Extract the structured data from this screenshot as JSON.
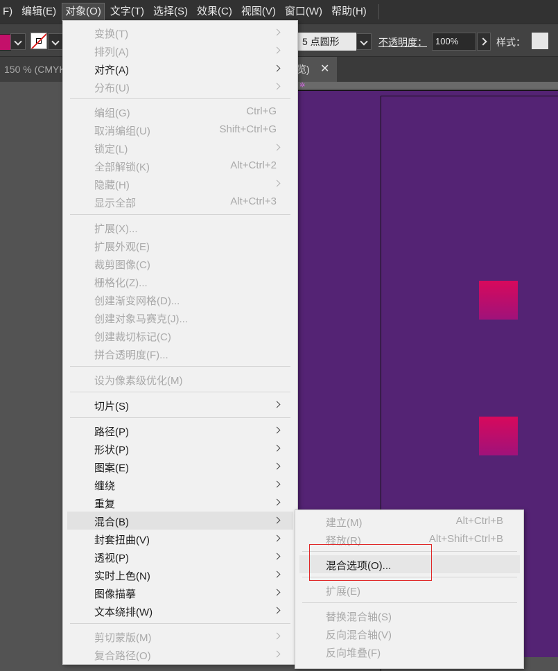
{
  "menubar": {
    "items": [
      "F)",
      "编辑(E)",
      "对象(O)",
      "文字(T)",
      "选择(S)",
      "效果(C)",
      "视图(V)",
      "窗口(W)",
      "帮助(H)"
    ],
    "active_index": 2
  },
  "controlbar": {
    "fill_color": "#c4106a",
    "brush": "5 点圆形",
    "opacity_label": "不透明度：",
    "opacity_value": "100%",
    "style_label": "样式："
  },
  "tabs": {
    "left_tab": "150 % (CMYK",
    "right_tab": "览)",
    "close_glyph": "✕"
  },
  "canvas": {
    "artboard_color": "#542374",
    "square_color": "#c4106a"
  },
  "object_menu": {
    "items": [
      {
        "label": "变换(T)",
        "shortcut": "",
        "submenu": true,
        "enabled": false
      },
      {
        "label": "排列(A)",
        "shortcut": "",
        "submenu": true,
        "enabled": false
      },
      {
        "label": "对齐(A)",
        "shortcut": "",
        "submenu": true,
        "enabled": true
      },
      {
        "label": "分布(U)",
        "shortcut": "",
        "submenu": true,
        "enabled": false
      },
      {
        "label": "编组(G)",
        "shortcut": "Ctrl+G",
        "submenu": false,
        "enabled": false
      },
      {
        "label": "取消编组(U)",
        "shortcut": "Shift+Ctrl+G",
        "submenu": false,
        "enabled": false
      },
      {
        "label": "锁定(L)",
        "shortcut": "",
        "submenu": true,
        "enabled": false
      },
      {
        "label": "全部解锁(K)",
        "shortcut": "Alt+Ctrl+2",
        "submenu": false,
        "enabled": false
      },
      {
        "label": "隐藏(H)",
        "shortcut": "",
        "submenu": true,
        "enabled": false
      },
      {
        "label": "显示全部",
        "shortcut": "Alt+Ctrl+3",
        "submenu": false,
        "enabled": false
      },
      {
        "label": "扩展(X)...",
        "shortcut": "",
        "submenu": false,
        "enabled": false
      },
      {
        "label": "扩展外观(E)",
        "shortcut": "",
        "submenu": false,
        "enabled": false
      },
      {
        "label": "裁剪图像(C)",
        "shortcut": "",
        "submenu": false,
        "enabled": false
      },
      {
        "label": "栅格化(Z)...",
        "shortcut": "",
        "submenu": false,
        "enabled": false
      },
      {
        "label": "创建渐变网格(D)...",
        "shortcut": "",
        "submenu": false,
        "enabled": false
      },
      {
        "label": "创建对象马赛克(J)...",
        "shortcut": "",
        "submenu": false,
        "enabled": false
      },
      {
        "label": "创建裁切标记(C)",
        "shortcut": "",
        "submenu": false,
        "enabled": false
      },
      {
        "label": "拼合透明度(F)...",
        "shortcut": "",
        "submenu": false,
        "enabled": false
      },
      {
        "label": "设为像素级优化(M)",
        "shortcut": "",
        "submenu": false,
        "enabled": false
      },
      {
        "label": "切片(S)",
        "shortcut": "",
        "submenu": true,
        "enabled": true
      },
      {
        "label": "路径(P)",
        "shortcut": "",
        "submenu": true,
        "enabled": true
      },
      {
        "label": "形状(P)",
        "shortcut": "",
        "submenu": true,
        "enabled": true
      },
      {
        "label": "图案(E)",
        "shortcut": "",
        "submenu": true,
        "enabled": true
      },
      {
        "label": "缠绕",
        "shortcut": "",
        "submenu": true,
        "enabled": true
      },
      {
        "label": "重复",
        "shortcut": "",
        "submenu": true,
        "enabled": true
      },
      {
        "label": "混合(B)",
        "shortcut": "",
        "submenu": true,
        "enabled": true,
        "hover": true
      },
      {
        "label": "封套扭曲(V)",
        "shortcut": "",
        "submenu": true,
        "enabled": true
      },
      {
        "label": "透视(P)",
        "shortcut": "",
        "submenu": true,
        "enabled": true
      },
      {
        "label": "实时上色(N)",
        "shortcut": "",
        "submenu": true,
        "enabled": true
      },
      {
        "label": "图像描摹",
        "shortcut": "",
        "submenu": true,
        "enabled": true
      },
      {
        "label": "文本绕排(W)",
        "shortcut": "",
        "submenu": true,
        "enabled": true
      },
      {
        "label": "剪切蒙版(M)",
        "shortcut": "",
        "submenu": true,
        "enabled": false
      },
      {
        "label": "复合路径(O)",
        "shortcut": "",
        "submenu": true,
        "enabled": false
      }
    ]
  },
  "blend_submenu": {
    "items": [
      {
        "label": "建立(M)",
        "shortcut": "Alt+Ctrl+B",
        "enabled": false
      },
      {
        "label": "释放(R)",
        "shortcut": "Alt+Shift+Ctrl+B",
        "enabled": false
      },
      {
        "label": "混合选项(O)...",
        "shortcut": "",
        "enabled": true,
        "hover": true
      },
      {
        "label": "扩展(E)",
        "shortcut": "",
        "enabled": false
      },
      {
        "label": "替换混合轴(S)",
        "shortcut": "",
        "enabled": false
      },
      {
        "label": "反向混合轴(V)",
        "shortcut": "",
        "enabled": false
      },
      {
        "label": "反向堆叠(F)",
        "shortcut": "",
        "enabled": false
      }
    ]
  }
}
